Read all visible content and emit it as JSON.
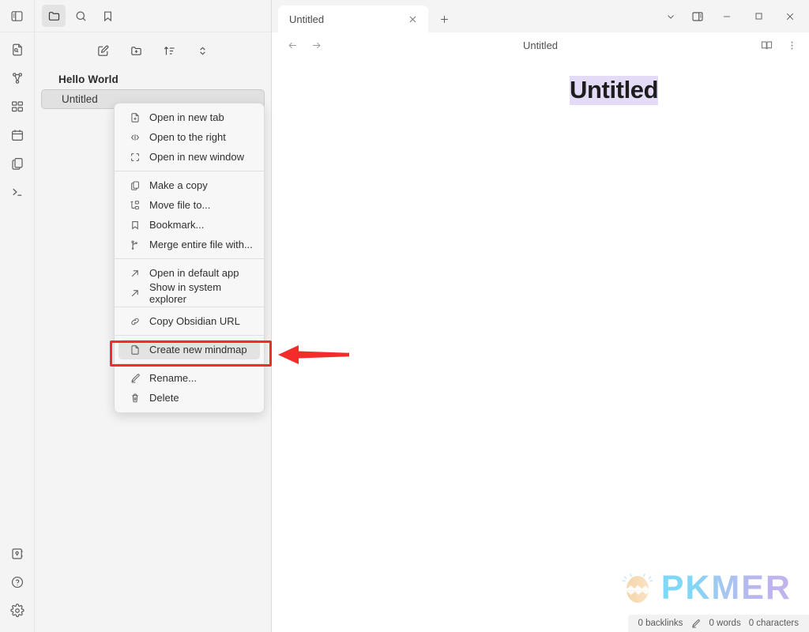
{
  "window": {
    "controls": [
      {
        "name": "chevron-down-icon",
        "label": "More"
      },
      {
        "name": "toggle-right-sidebar-icon",
        "label": "Toggle right sidebar"
      },
      {
        "name": "minimize-icon",
        "label": "Minimize"
      },
      {
        "name": "maximize-icon",
        "label": "Maximize"
      },
      {
        "name": "close-icon",
        "label": "Close"
      }
    ]
  },
  "ribbon": {
    "toggle_sidebar": "Toggle left sidebar",
    "icons": [
      {
        "name": "file-search-icon",
        "label": "Search in file"
      },
      {
        "name": "graph-view-icon",
        "label": "Open graph view"
      },
      {
        "name": "canvas-grid-icon",
        "label": "Canvas"
      },
      {
        "name": "calendar-icon",
        "label": "Calendar"
      },
      {
        "name": "files-copy-icon",
        "label": "Templates"
      },
      {
        "name": "terminal-icon",
        "label": "Terminal"
      }
    ],
    "bottom_icons": [
      {
        "name": "vault-switcher-icon",
        "label": "Open another vault"
      },
      {
        "name": "help-icon",
        "label": "Help"
      },
      {
        "name": "settings-gear-icon",
        "label": "Settings"
      }
    ]
  },
  "sidebar": {
    "tabs": [
      {
        "name": "files-tab-icon",
        "label": "Files",
        "active": true
      },
      {
        "name": "search-tab-icon",
        "label": "Search",
        "active": false
      },
      {
        "name": "bookmarks-tab-icon",
        "label": "Bookmarks",
        "active": false
      }
    ],
    "nav_buttons": [
      {
        "name": "new-note-icon",
        "label": "New note"
      },
      {
        "name": "new-folder-icon",
        "label": "New folder"
      },
      {
        "name": "sort-order-icon",
        "label": "Change sort order"
      },
      {
        "name": "collapse-expand-icon",
        "label": "Collapse all"
      }
    ],
    "tree": {
      "folder": "Hello World",
      "files": [
        {
          "label": "Untitled",
          "selected": true
        }
      ]
    }
  },
  "tabbar": {
    "tabs": [
      {
        "title": "Untitled",
        "active": true
      }
    ],
    "new_tab_label": "+"
  },
  "view_header": {
    "back_label": "Back",
    "forward_label": "Forward",
    "title": "Untitled",
    "reading_view_label": "Reading view",
    "more_options_label": "More options"
  },
  "editor": {
    "doc_title": "Untitled"
  },
  "context_menu": {
    "groups": [
      {
        "items": [
          {
            "icon": "file-plus-icon",
            "label": "Open in new tab"
          },
          {
            "icon": "split-right-icon",
            "label": "Open to the right"
          },
          {
            "icon": "new-window-icon",
            "label": "Open in new window"
          }
        ]
      },
      {
        "items": [
          {
            "icon": "copy-icon",
            "label": "Make a copy"
          },
          {
            "icon": "move-file-icon",
            "label": "Move file to..."
          },
          {
            "icon": "bookmark-icon",
            "label": "Bookmark..."
          },
          {
            "icon": "merge-icon",
            "label": "Merge entire file with..."
          }
        ]
      },
      {
        "items": [
          {
            "icon": "external-link-icon",
            "label": "Open in default app"
          },
          {
            "icon": "external-link-icon",
            "label": "Show in system explorer"
          }
        ]
      },
      {
        "items": [
          {
            "icon": "link-icon",
            "label": "Copy Obsidian URL"
          }
        ]
      },
      {
        "items": [
          {
            "icon": "document-icon",
            "label": "Create new mindmap",
            "highlighted": true
          }
        ]
      },
      {
        "items": [
          {
            "icon": "pencil-icon",
            "label": "Rename..."
          },
          {
            "icon": "trash-icon",
            "label": "Delete"
          }
        ]
      }
    ]
  },
  "annotation": {
    "box_color": "#f42b2b",
    "arrow_color": "#f42b2b",
    "target_label": "Create new mindmap"
  },
  "watermark": {
    "text": "PKMER",
    "logo_name": "pkmer-egg-logo"
  },
  "statusbar": {
    "backlinks": "0 backlinks",
    "pencil_icon": "edit-pencil-icon",
    "words": "0 words",
    "characters": "0 characters"
  }
}
